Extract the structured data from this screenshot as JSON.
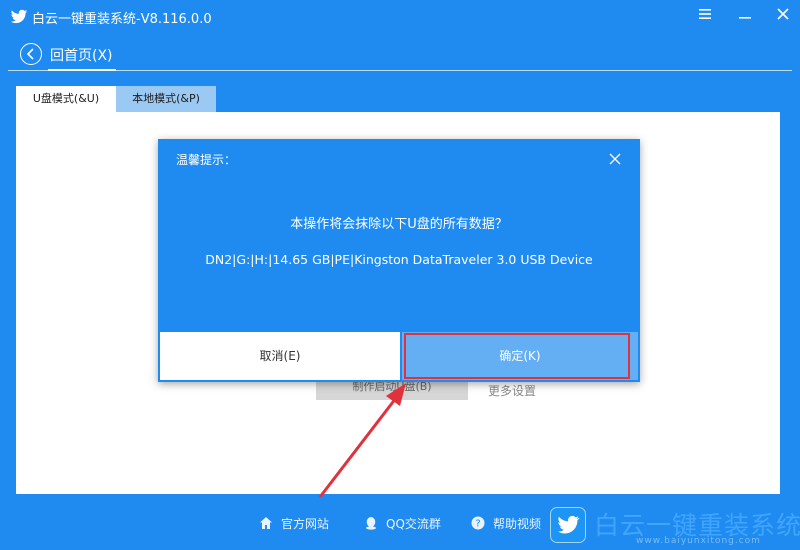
{
  "window": {
    "title": "白云一键重装系统-V8.116.0.0",
    "menu_icon": "menu-icon",
    "minimize_icon": "minimize-icon",
    "close_icon": "close-icon"
  },
  "nav": {
    "back_label": "回首页(X)",
    "back_icon": "arrow-left-circle-icon"
  },
  "tabs": [
    {
      "label": "U盘模式(&U)",
      "active": true
    },
    {
      "label": "本地模式(&P)",
      "active": false
    }
  ],
  "background_content": {
    "make_boot_button": "制作启动U盘(B)",
    "more_settings_link": "更多设置"
  },
  "dialog": {
    "title": "温馨提示：",
    "message": "本操作将会抹除以下U盘的所有数据？",
    "device": "DN2|G:|H:|14.65 GB|PE|Kingston DataTraveler 3.0 USB Device",
    "cancel_label": "取消(E)",
    "ok_label": "确定(K)",
    "highlight_color": "#e0323c"
  },
  "footer": {
    "items": [
      {
        "label": "官方网站",
        "icon": "home-icon"
      },
      {
        "label": "QQ交流群",
        "icon": "qq-icon"
      },
      {
        "label": "帮助视频",
        "icon": "help-icon"
      }
    ]
  },
  "watermark": {
    "name": "白云一键重装系统",
    "url": "www.baiyunxitong.com"
  },
  "colors": {
    "primary": "#1f8bf0",
    "dialog_ok_button": "#64aef3",
    "annotation_red": "#e0323c"
  }
}
